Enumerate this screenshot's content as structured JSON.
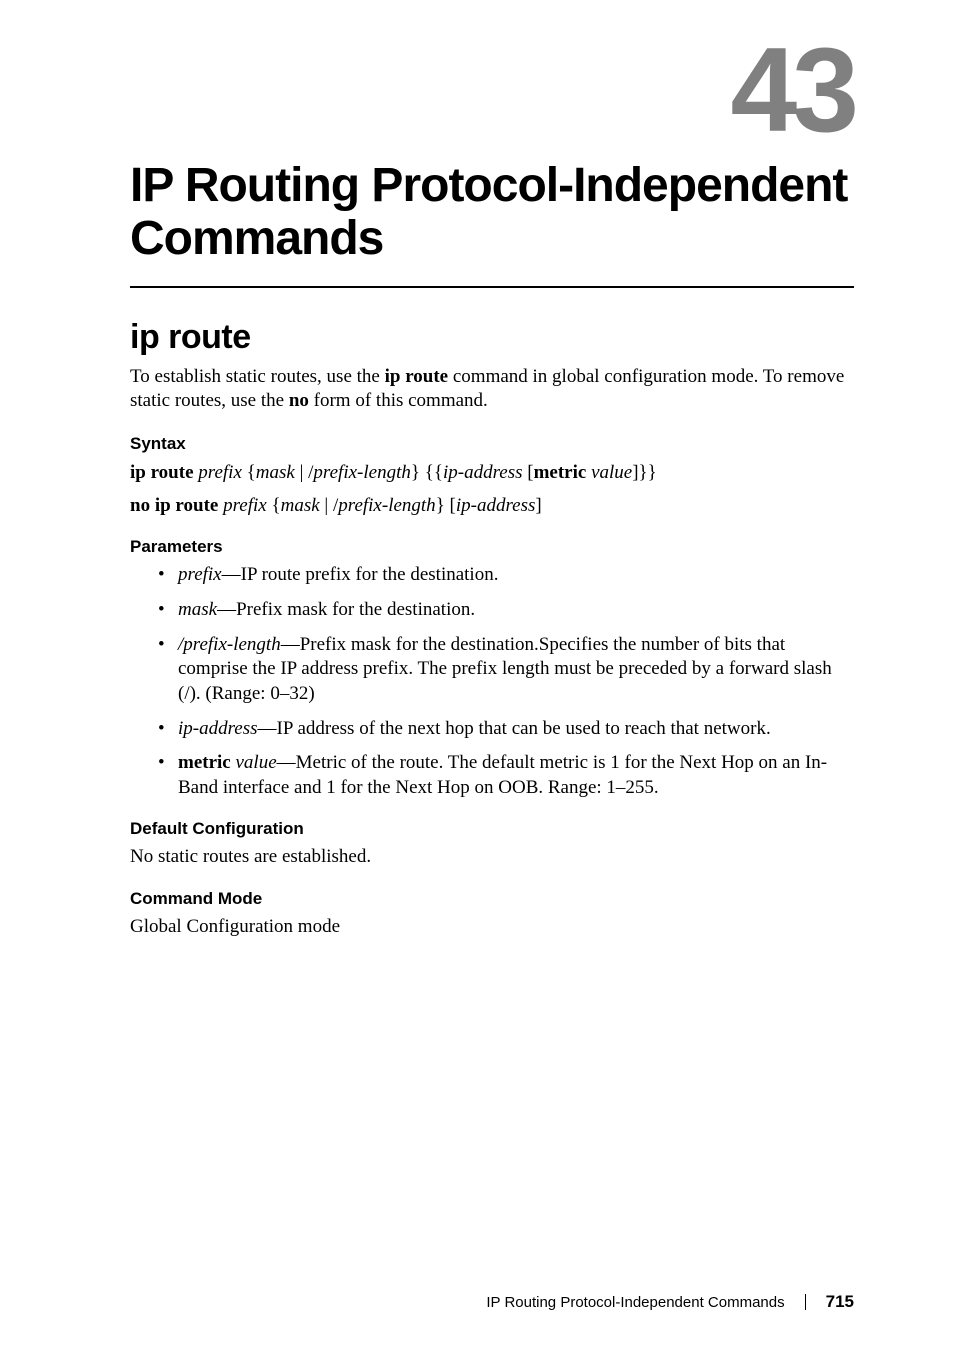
{
  "chapter": {
    "number": "43",
    "title": "IP Routing Protocol-Independent Commands"
  },
  "section": {
    "title": "ip route",
    "intro_part1": "To establish static routes, use the ",
    "intro_cmd1": "ip route",
    "intro_part2": " command in global configuration mode. To remove static routes, use the ",
    "intro_cmd2": "no",
    "intro_part3": " form of this command."
  },
  "syntax": {
    "heading": "Syntax",
    "line1": {
      "cmd": "ip route ",
      "p1": "prefix",
      "t1": " {",
      "p2": "mask",
      "t2": "  | /",
      "p3": "prefix-length",
      "t3": "} {{",
      "p4": "ip-address",
      "t4": " [",
      "cmd2": "metric ",
      "p5": "value",
      "t5": "]}}"
    },
    "line2": {
      "cmd": "no ip route ",
      "p1": "prefix",
      "t1": " {",
      "p2": "mask",
      "t2": "  | /",
      "p3": "prefix-length",
      "t3": "} [",
      "p4": "ip-address",
      "t4": "]"
    }
  },
  "parameters": {
    "heading": "Parameters",
    "items": [
      {
        "term": "prefix",
        "desc": "—IP route prefix for the destination.",
        "term_italic": true
      },
      {
        "term": "mask",
        "desc": "—Prefix mask for the destination.",
        "term_italic": true
      },
      {
        "term": "/prefix-length",
        "desc": "—Prefix mask for the destination.Specifies the number of bits that comprise the IP address prefix. The prefix length must be preceded by a forward slash (/). (Range: 0–32)",
        "term_italic": true
      },
      {
        "term": "ip-address",
        "desc": "—IP address of the next hop that can be used to reach that network.",
        "term_italic": true
      },
      {
        "term": "metric",
        "term_bold": true,
        "term2": " value",
        "term2_italic": true,
        "desc": "—Metric of the route. The default metric is 1 for the Next Hop on an In-Band interface and 1 for the Next Hop on OOB. Range: 1–255."
      }
    ]
  },
  "default_config": {
    "heading": "Default Configuration",
    "text": "No static routes are established."
  },
  "command_mode": {
    "heading": "Command Mode",
    "text": "Global Configuration mode"
  },
  "footer": {
    "title": "IP Routing Protocol-Independent Commands",
    "page": "715"
  }
}
